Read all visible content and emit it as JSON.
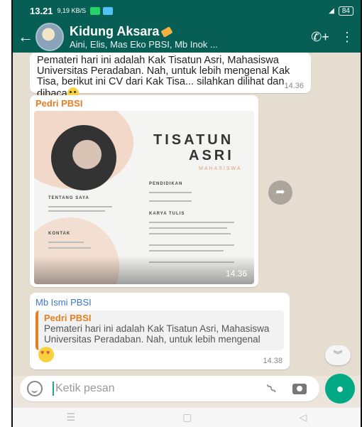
{
  "status_bar": {
    "time": "13.21",
    "network": "9,19 KB/S",
    "battery": "84"
  },
  "header": {
    "group_name": "Kidung Aksara",
    "members": "Aini, Elis, Mas Eko PBSI, Mb Inok ..."
  },
  "messages": [
    {
      "text": "Pemateri hari ini adalah Kak Tisatun Asri, Mahasiswa Universitas Peradaban.  Nah, untuk lebih mengenal Kak Tisa, berikut ini CV dari Kak Tisa... silahkan dilihat dan dibaca",
      "time": "14.36"
    },
    {
      "sender": "Pedri PBSI",
      "image": {
        "name_line1": "TISATUN",
        "name_line2": "ASRI",
        "role": "MAHASISWA",
        "sections": [
          "TENTANG SAYA",
          "PENDIDIKAN",
          "KARYA TULIS",
          "KONTAK"
        ]
      },
      "time": "14.36"
    },
    {
      "sender": "Mb Ismi PBSI",
      "quoted_sender": "Pedri PBSI",
      "quoted_text": "Pemateri hari ini adalah Kak Tisatun Asri, Mahasiswa Universitas Peradaban.  Nah, untuk lebih mengenal Kak Tisa, berikut ini CV...",
      "time": "14.38"
    }
  ],
  "input": {
    "placeholder": "Ketik pesan"
  },
  "colors": {
    "header": "#075e54",
    "accent": "#00a884",
    "chat_bg": "#e5ddd0"
  }
}
